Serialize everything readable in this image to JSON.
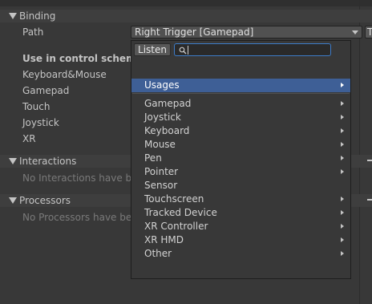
{
  "binding": {
    "header": "Binding",
    "path_label": "Path",
    "path_value": "Right Trigger [Gamepad]",
    "side_button_label": "T",
    "scheme_heading": "Use in control scheme",
    "schemes": [
      "Keyboard&Mouse",
      "Gamepad",
      "Touch",
      "Joystick",
      "XR"
    ]
  },
  "interactions": {
    "header": "Interactions",
    "empty_text": "No Interactions have bee"
  },
  "processors": {
    "header": "Processors",
    "empty_text": "No Processors have bee"
  },
  "dropdown": {
    "listen_label": "Listen",
    "search_value": "",
    "selected_item": "Usages",
    "items": [
      {
        "label": "Usages",
        "has_submenu": true
      },
      {
        "label": "Gamepad",
        "has_submenu": true
      },
      {
        "label": "Joystick",
        "has_submenu": true
      },
      {
        "label": "Keyboard",
        "has_submenu": true
      },
      {
        "label": "Mouse",
        "has_submenu": true
      },
      {
        "label": "Pen",
        "has_submenu": true
      },
      {
        "label": "Pointer",
        "has_submenu": true
      },
      {
        "label": "Sensor",
        "has_submenu": false
      },
      {
        "label": "Touchscreen",
        "has_submenu": true
      },
      {
        "label": "Tracked Device",
        "has_submenu": true
      },
      {
        "label": "XR Controller",
        "has_submenu": true
      },
      {
        "label": "XR HMD",
        "has_submenu": true
      },
      {
        "label": "Other",
        "has_submenu": true
      }
    ]
  },
  "colors": {
    "background": "#383838",
    "selection": "#3e5f96",
    "search_focus": "#3d7cc9",
    "text": "#c4c4c4"
  }
}
